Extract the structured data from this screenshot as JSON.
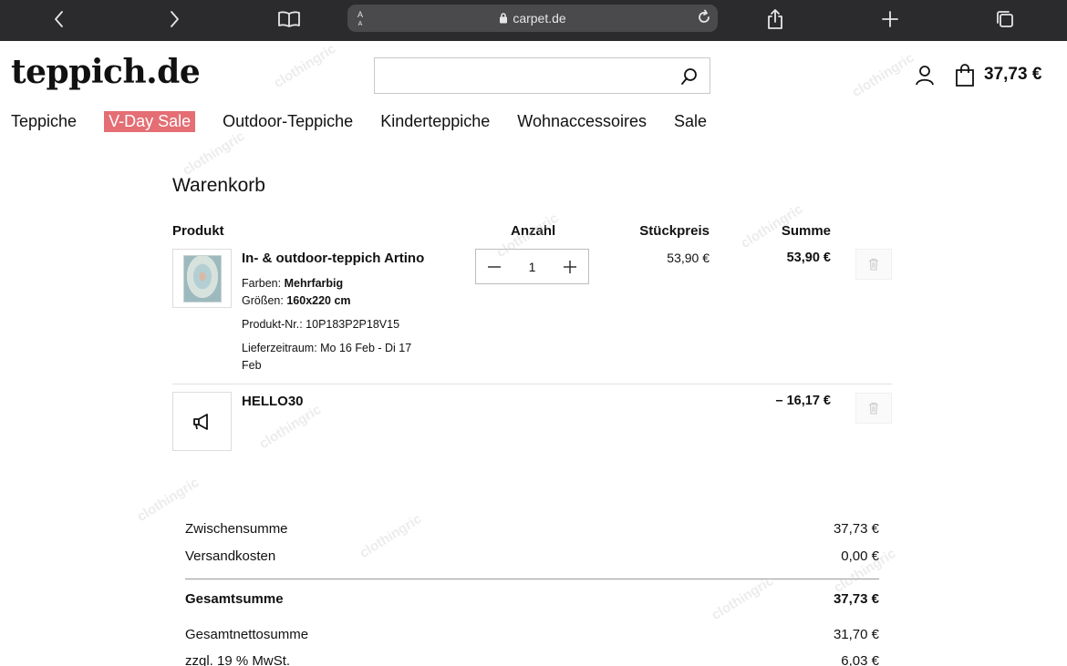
{
  "browser": {
    "url": "carpet.de",
    "text_size_label": "A"
  },
  "header": {
    "logo": "teppich.de",
    "search_placeholder": "",
    "cart_total": "37,73 €"
  },
  "nav": {
    "items": [
      "Teppiche",
      "V-Day Sale",
      "Outdoor-Teppiche",
      "Kinderteppiche",
      "Wohnaccessoires",
      "Sale"
    ]
  },
  "cart": {
    "title": "Warenkorb",
    "columns": {
      "product": "Produkt",
      "quantity": "Anzahl",
      "unit_price": "Stückpreis",
      "sum": "Summe"
    },
    "item": {
      "name": "In- & outdoor-teppich Artino",
      "color_label": "Farben:",
      "color_value": "Mehrfarbig",
      "size_label": "Größen:",
      "size_value": "160x220 cm",
      "product_no": "Produkt-Nr.: 10P183P2P18V15",
      "delivery_line1": "Lieferzeitraum: Mo 16 Feb - Di 17",
      "delivery_line2": "Feb",
      "quantity": "1",
      "unit_price": "53,90 €",
      "sum": "53,90 €"
    },
    "promo": {
      "code": "HELLO30",
      "amount": "– 16,17 €"
    }
  },
  "totals": {
    "subtotal_label": "Zwischensumme",
    "subtotal": "37,73 €",
    "shipping_label": "Versandkosten",
    "shipping": "0,00 €",
    "total_label": "Gesamtsumme",
    "total": "37,73 €",
    "net_label": "Gesamtnettosumme",
    "net": "31,70 €",
    "vat_label": "zzgl. 19 % MwSt.",
    "vat": "6,03 €"
  },
  "watermark": "clothingric"
}
